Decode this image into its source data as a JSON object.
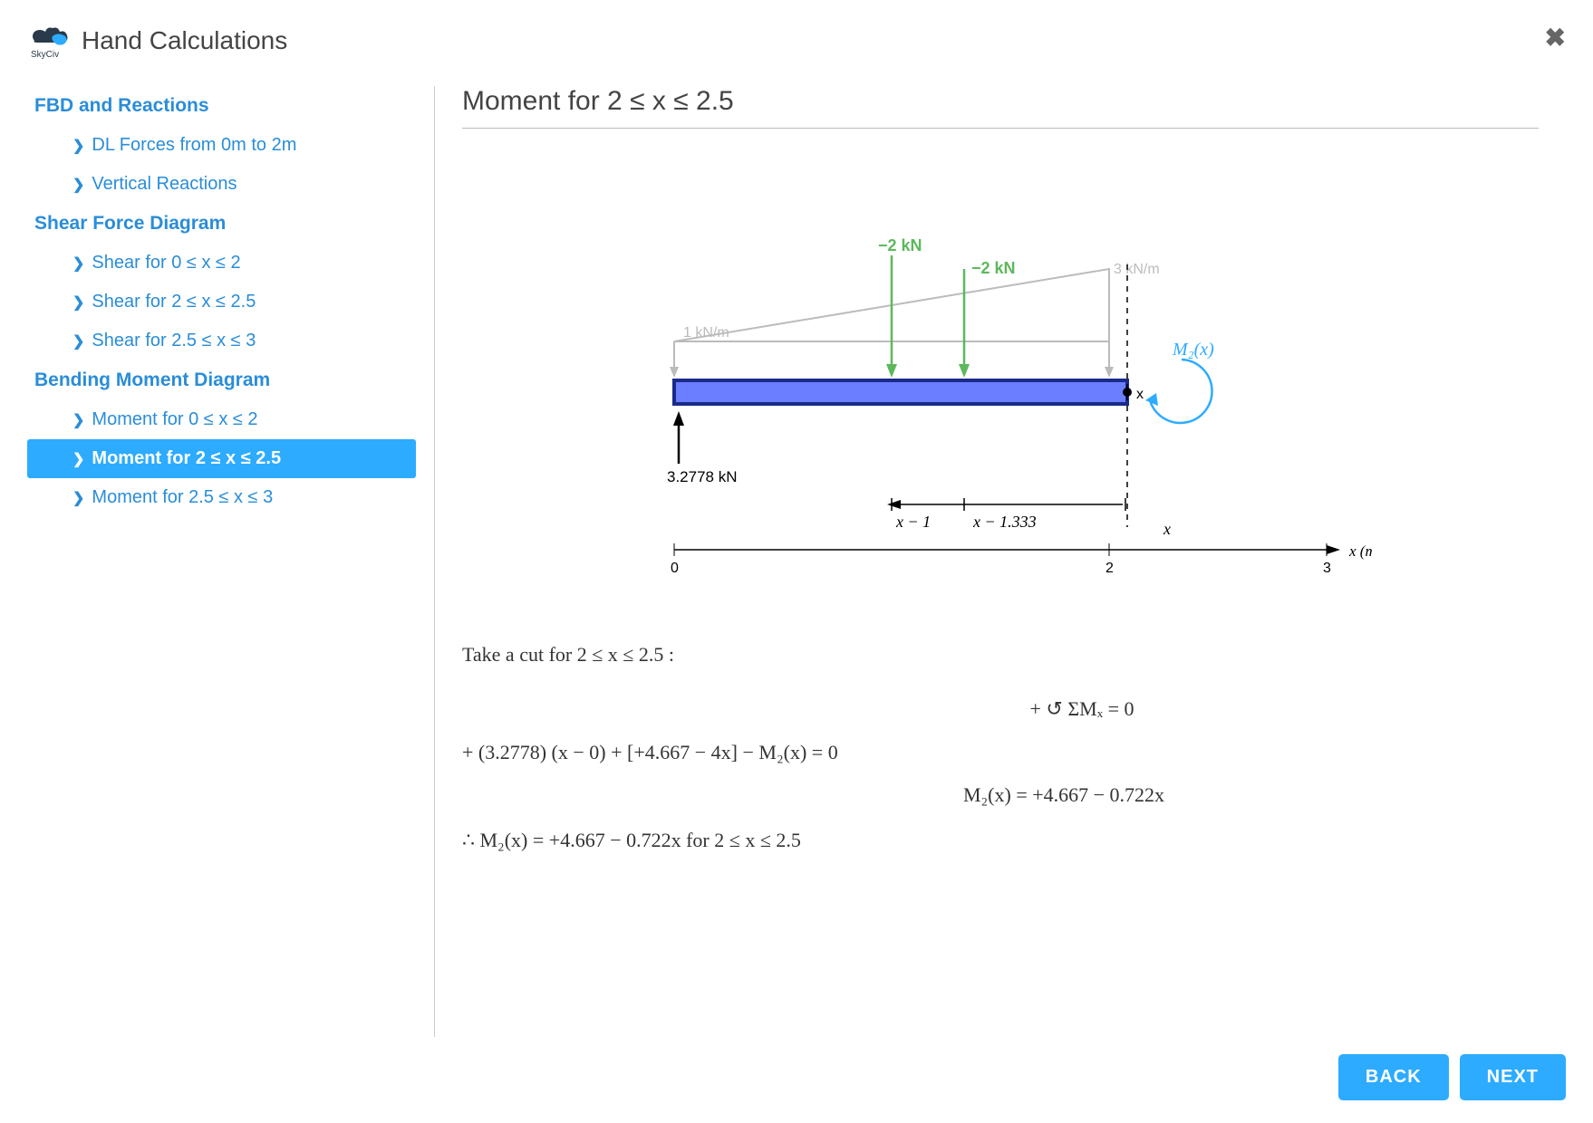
{
  "header": {
    "title": "Hand Calculations"
  },
  "sidebar": {
    "groups": [
      {
        "title": "FBD and Reactions",
        "items": [
          {
            "label": "DL Forces from 0m to 2m",
            "active": false
          },
          {
            "label": "Vertical Reactions",
            "active": false
          }
        ]
      },
      {
        "title": "Shear Force Diagram",
        "items": [
          {
            "label": "Shear for 0 ≤ x ≤ 2",
            "active": false
          },
          {
            "label": "Shear for 2 ≤ x ≤ 2.5",
            "active": false
          },
          {
            "label": "Shear for 2.5 ≤ x ≤ 3",
            "active": false
          }
        ]
      },
      {
        "title": "Bending Moment Diagram",
        "items": [
          {
            "label": "Moment for 0 ≤ x ≤ 2",
            "active": false
          },
          {
            "label": "Moment for 2 ≤ x ≤ 2.5",
            "active": true
          },
          {
            "label": "Moment for 2.5 ≤ x ≤ 3",
            "active": false
          }
        ]
      }
    ]
  },
  "main": {
    "title": "Moment for 2 ≤ x ≤ 2.5",
    "diagram": {
      "loads": {
        "point_load_1": "−2 kN",
        "point_load_2": "−2 kN",
        "dist_left": "1 kN/m",
        "dist_right": "3 kN/m",
        "reaction": "3.2778 kN",
        "moment_label": "M₂(x)",
        "cut_label": "x"
      },
      "dims": {
        "d1": "x − 1",
        "d2": "x − 1.333",
        "d3": "x"
      },
      "axis": {
        "ticks": [
          "0",
          "2",
          "3"
        ],
        "label": "x (m)"
      }
    },
    "calc": {
      "intro": "Take a cut for 2 ≤ x ≤ 2.5 :",
      "line1": "+ ↺ ΣMₓ = 0",
      "line2": "+ (3.2778) (x − 0) + [+4.667 − 4x] − M₂(x) = 0",
      "line3": "M₂(x) = +4.667 − 0.722x",
      "line4": "∴ M₂(x) = +4.667 − 0.722x   for   2 ≤ x ≤ 2.5"
    }
  },
  "footer": {
    "back": "BACK",
    "next": "NEXT"
  }
}
